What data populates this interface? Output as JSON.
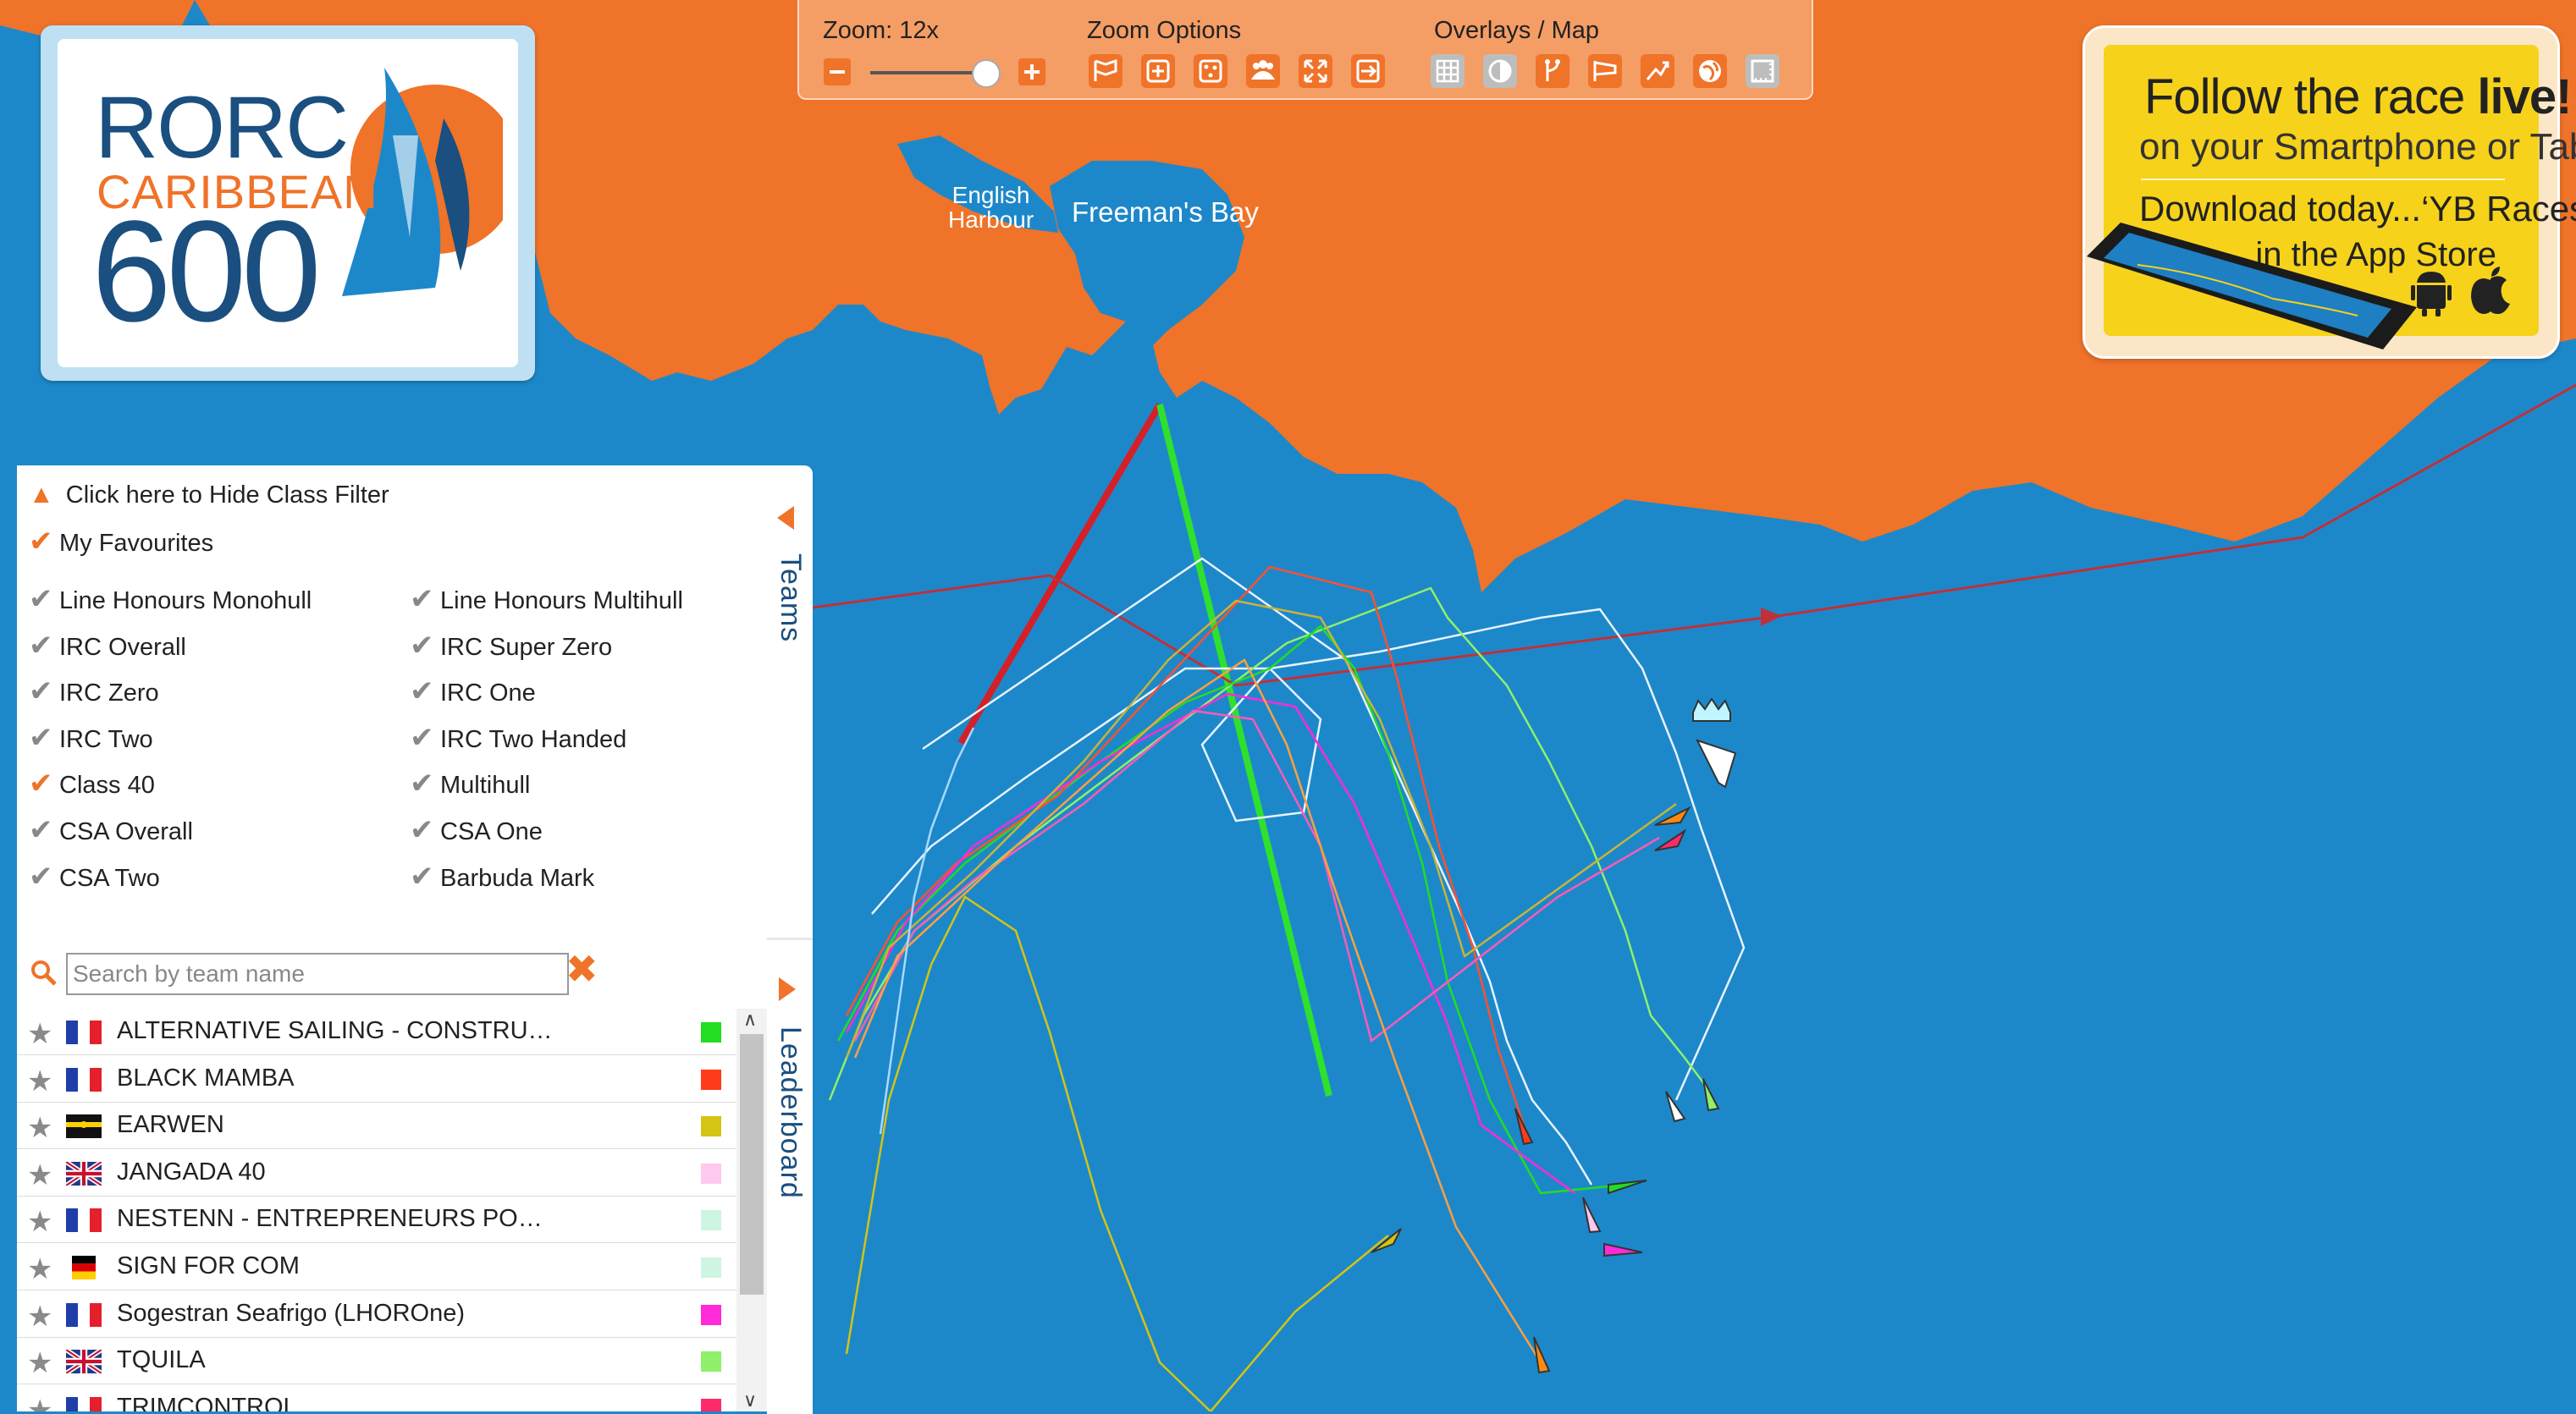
{
  "map": {
    "place_english_harbour": "English\nHarbour",
    "place_freemans_bay": "Freeman's Bay",
    "colors": {
      "sea": "#1d88c9",
      "land": "#ef7329"
    }
  },
  "logo": {
    "line1": "RORC",
    "line2": "CARIBBEAN",
    "line3": "600"
  },
  "toolbar": {
    "zoom_label": "Zoom: 12x",
    "zoom_level": 12,
    "zoom_options_label": "Zoom Options",
    "overlays_label": "Overlays / Map",
    "zoom_out_icon": "minus-icon",
    "zoom_in_icon": "plus-icon"
  },
  "ad": {
    "title_normal": "Follow the race ",
    "title_bold": "live!",
    "line2": "on your Smartphone or Tab",
    "line3": "Download today...‘YB Races’",
    "line4": "in the App Store"
  },
  "filter": {
    "hide_label": "Click here to Hide Class Filter",
    "favourites_label": "My Favourites",
    "classes_left": [
      "Line Honours Monohull",
      "IRC Overall",
      "IRC Zero",
      "IRC Two",
      "Class 40",
      "CSA Overall",
      "CSA Two"
    ],
    "classes_right": [
      "Line Honours Multihull",
      "IRC Super Zero",
      "IRC One",
      "IRC Two Handed",
      "Multihull",
      "CSA One",
      "Barbuda Mark"
    ],
    "search_placeholder": "Search by team name"
  },
  "tabs": {
    "teams": "Teams",
    "leaderboard": "Leaderboard"
  },
  "teams": [
    {
      "name": "ALTERNATIVE SAILING - CONSTRU…",
      "flag": "fr",
      "color": "#22dd22"
    },
    {
      "name": "BLACK MAMBA",
      "flag": "fr",
      "color": "#ff3b1a"
    },
    {
      "name": "EARWEN",
      "flag": "other",
      "color": "#d4c414"
    },
    {
      "name": "JANGADA 40",
      "flag": "gb",
      "color": "#ffc8ee"
    },
    {
      "name": "NESTENN - ENTREPRENEURS PO…",
      "flag": "fr",
      "color": "#cdf5e2"
    },
    {
      "name": "SIGN FOR COM",
      "flag": "de",
      "color": "#cdf5e2"
    },
    {
      "name": "Sogestran Seafrigo (LHOROne)",
      "flag": "fr",
      "color": "#ff2ad8"
    },
    {
      "name": "TQUILA",
      "flag": "gb",
      "color": "#8ff06a"
    },
    {
      "name": "TRIMCONTROL",
      "flag": "fr",
      "color": "#ff2a6a"
    }
  ]
}
